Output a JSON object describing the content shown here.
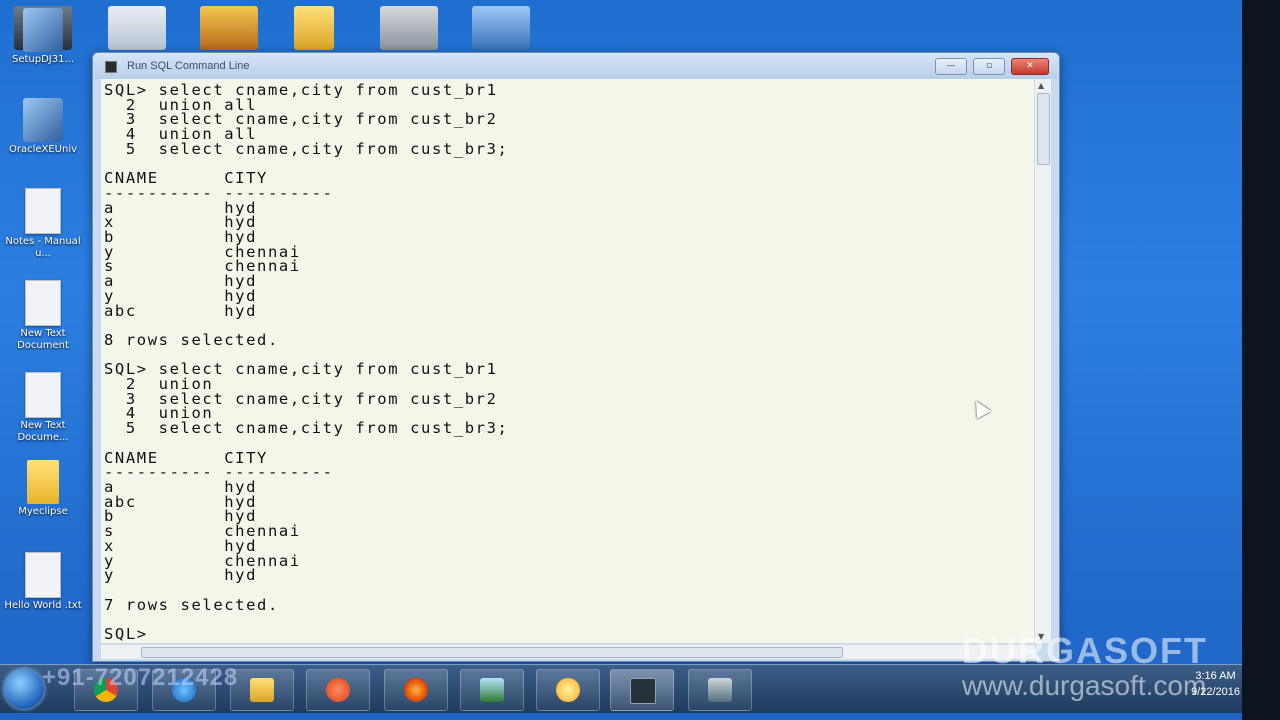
{
  "desktop": {
    "icons": [
      {
        "label": "SetupDJ31...",
        "icon": "setup-icon"
      },
      {
        "label": "OracleXEUniv",
        "icon": "oracle-installer-icon"
      },
      {
        "label": "Notes - Manual u...",
        "icon": "document-icon"
      },
      {
        "label": "New Text Document",
        "icon": "text-document-icon"
      },
      {
        "label": "New Text Docume...",
        "icon": "text-document-icon"
      },
      {
        "label": "Myeclipse",
        "icon": "folder-icon"
      },
      {
        "label": "Hello World .txt",
        "icon": "text-document-icon"
      }
    ],
    "top_icons": [
      "computer-icon",
      "document-icon",
      "tomcat-icon",
      "folder-icon",
      "oracle-xe-icon",
      "network-icon"
    ]
  },
  "window": {
    "title": "Run SQL Command Line",
    "buttons": {
      "minimize": "—",
      "maximize": "▫",
      "close": "✕"
    }
  },
  "console": {
    "lines": [
      "SQL> select cname,city from cust_br1",
      "  2  union all",
      "  3  select cname,city from cust_br2",
      "  4  union all",
      "  5  select cname,city from cust_br3;",
      "",
      "CNAME      CITY",
      "---------- ----------",
      "a          hyd",
      "x          hyd",
      "b          hyd",
      "y          chennai",
      "s          chennai",
      "a          hyd",
      "y          hyd",
      "abc        hyd",
      "",
      "8 rows selected.",
      "",
      "SQL> select cname,city from cust_br1",
      "  2  union",
      "  3  select cname,city from cust_br2",
      "  4  union",
      "  5  select cname,city from cust_br3;",
      "",
      "CNAME      CITY",
      "---------- ----------",
      "a          hyd",
      "abc        hyd",
      "b          hyd",
      "s          chennai",
      "x          hyd",
      "y          chennai",
      "y          hyd",
      "",
      "7 rows selected.",
      "",
      "SQL> "
    ]
  },
  "overlay": {
    "phone": "+91-7207212428",
    "watermark_brand": "DURGASOFT",
    "watermark_site": "www.durgasoft.com"
  },
  "taskbar": {
    "pinned": [
      "chrome-icon",
      "ie-icon",
      "explorer-icon",
      "media-player-icon",
      "firefox-icon",
      "checklist-icon",
      "sun-app-icon",
      "sql-command-line-icon",
      "network-admin-icon"
    ],
    "time": "3:16 AM",
    "date": "9/22/2016"
  },
  "colors": {
    "desktop": "#2a7fe0",
    "console_bg": "#f3f7ea",
    "title_bar": "#c7daf0",
    "close_button": "#c23a2d"
  }
}
